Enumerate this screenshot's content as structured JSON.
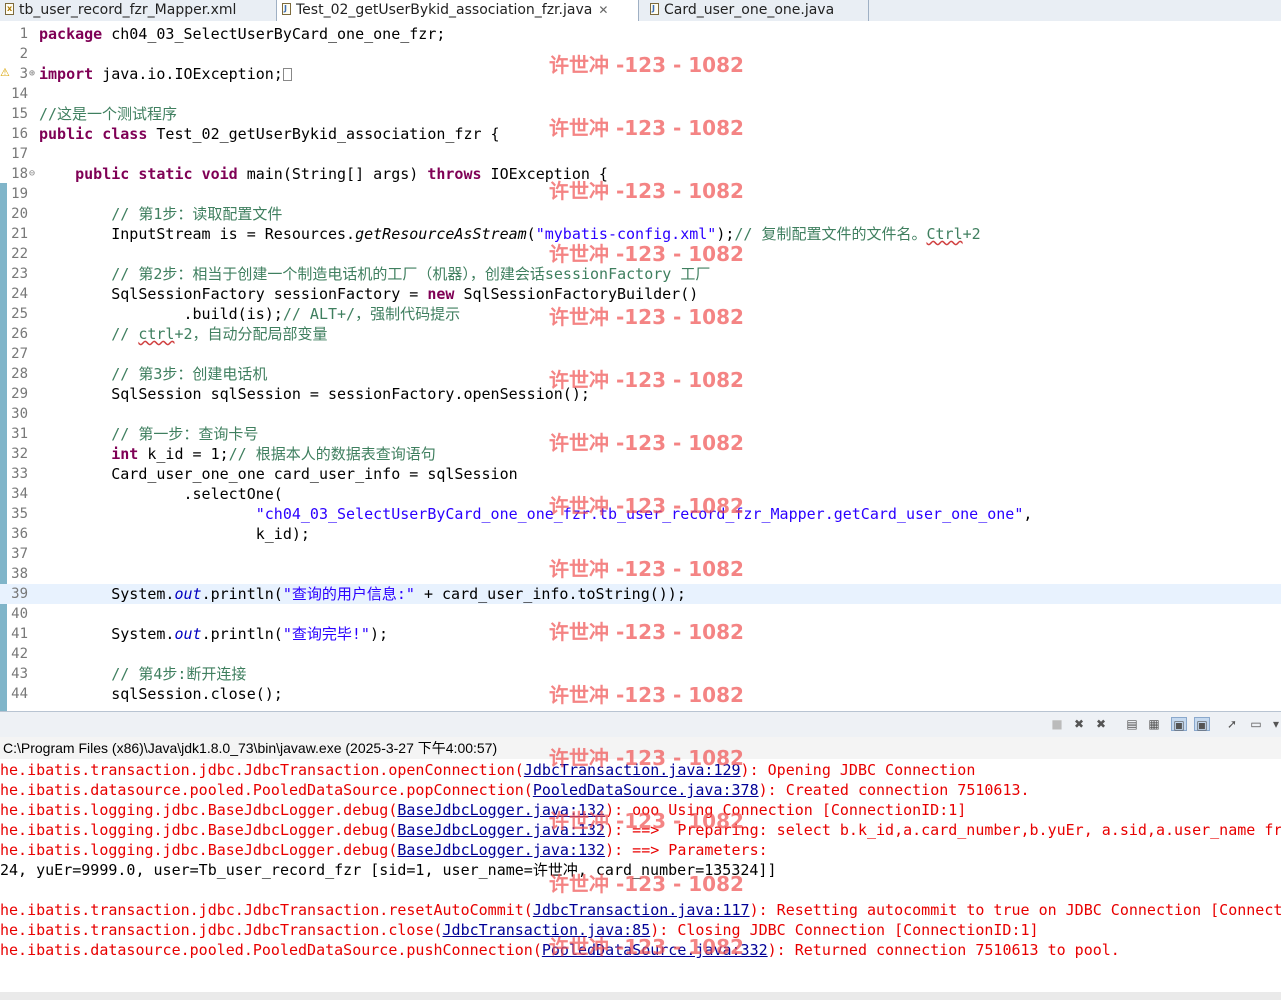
{
  "tabs": [
    {
      "label": "tb_user_record_fzr_Mapper.xml",
      "active": false,
      "icon": "xml-file-icon"
    },
    {
      "label": "Test_02_getUserBykid_association_fzr.java",
      "active": true,
      "icon": "java-file-icon",
      "close": "✕"
    },
    {
      "label": "Card_user_one_one.java",
      "active": false,
      "icon": "java-file-icon"
    }
  ],
  "editor": {
    "lines": [
      {
        "n": "1",
        "html": "<span class='kw'>package</span> ch04_03_SelectUserByCard_one_one_fzr;"
      },
      {
        "n": "2",
        "html": ""
      },
      {
        "n": "3",
        "warn": true,
        "fold": "⊕",
        "html": "<span class='kw'>import</span> java.io.IOException;<span class='fold-box'></span>"
      },
      {
        "n": "14",
        "html": ""
      },
      {
        "n": "15",
        "html": "<span class='cm'>//这是一个测试程序</span>"
      },
      {
        "n": "16",
        "html": "<span class='kw'>public</span> <span class='kw'>class</span> Test_02_getUserBykid_association_fzr {"
      },
      {
        "n": "17",
        "html": ""
      },
      {
        "n": "18",
        "fold": "⊖",
        "html": "    <span class='kw'>public</span> <span class='kw'>static</span> <span class='kw'>void</span> main(String[] args) <span class='kw'>throws</span> IOException {"
      },
      {
        "n": "19",
        "html": ""
      },
      {
        "n": "20",
        "html": "        <span class='cm'>// 第1步：读取配置文件</span>"
      },
      {
        "n": "21",
        "html": "        InputStream is = Resources.<span class='itm'>getResourceAsStream</span>(<span class='st'>\"mybatis-config.xml\"</span>);<span class='cm'>// 复制配置文件的文件名。<span class='sp'>Ctrl</span>+2</span>"
      },
      {
        "n": "22",
        "html": ""
      },
      {
        "n": "23",
        "html": "        <span class='cm'>// 第2步：相当于创建一个制造电话机的工厂（机器），创建会话sessionFactory 工厂</span>"
      },
      {
        "n": "24",
        "html": "        SqlSessionFactory sessionFactory = <span class='kw'>new</span> SqlSessionFactoryBuilder()"
      },
      {
        "n": "25",
        "html": "                .build(is);<span class='cm'>// ALT+/，强制代码提示</span>"
      },
      {
        "n": "26",
        "html": "        <span class='cm'>// <span class='sp'>ctrl</span>+2，自动分配局部变量</span>"
      },
      {
        "n": "27",
        "html": ""
      },
      {
        "n": "28",
        "html": "        <span class='cm'>// 第3步：创建电话机</span>"
      },
      {
        "n": "29",
        "html": "        SqlSession sqlSession = sessionFactory.openSession();"
      },
      {
        "n": "30",
        "html": ""
      },
      {
        "n": "31",
        "html": "        <span class='cm'>// 第一步：查询卡号</span>"
      },
      {
        "n": "32",
        "html": "        <span class='kw'>int</span> k_id = 1;<span class='cm'>// 根据本人的数据表查询语句</span>"
      },
      {
        "n": "33",
        "html": "        Card_user_one_one card_user_info = sqlSession"
      },
      {
        "n": "34",
        "html": "                .selectOne("
      },
      {
        "n": "35",
        "html": "                        <span class='st'>\"ch04_03_SelectUserByCard_one_one_fzr.tb_user_record_fzr_Mapper.getCard_user_one_one\"</span>,"
      },
      {
        "n": "36",
        "html": "                        k_id);"
      },
      {
        "n": "37",
        "html": ""
      },
      {
        "n": "38",
        "html": ""
      },
      {
        "n": "39",
        "hl": true,
        "html": "        System.<span class='fd'>out</span>.println(<span class='st'>\"查询的用户信息:\"</span> + card_user_info.toString());"
      },
      {
        "n": "40",
        "html": ""
      },
      {
        "n": "41",
        "html": "        System.<span class='fd'>out</span>.println(<span class='st'>\"查询完毕!\"</span>);"
      },
      {
        "n": "42",
        "html": ""
      },
      {
        "n": "43",
        "html": "        <span class='cm'>// 第4步:断开连接</span>"
      },
      {
        "n": "44",
        "html": "        sqlSession.close();"
      }
    ]
  },
  "console_toolbar": {
    "buttons": [
      {
        "name": "terminate-icon",
        "glyph": "■"
      },
      {
        "name": "remove-launch-icon",
        "glyph": "✖"
      },
      {
        "name": "remove-all-launches-icon",
        "glyph": "✖"
      },
      {
        "name": "clear-console-icon",
        "glyph": "▤"
      },
      {
        "name": "scroll-lock-icon",
        "glyph": "▦"
      },
      {
        "name": "show-on-stdout-icon",
        "glyph": "▣",
        "active": true
      },
      {
        "name": "show-on-stderr-icon",
        "glyph": "▣",
        "active": true
      },
      {
        "name": "pin-console-icon",
        "glyph": "➚"
      },
      {
        "name": "display-console-icon",
        "glyph": "▭"
      },
      {
        "name": "view-menu-icon",
        "glyph": "▾"
      }
    ]
  },
  "console": {
    "terminated": "C:\\Program Files (x86)\\Java\\jdk1.8.0_73\\bin\\javaw.exe (2025-3-27 下午4:00:57)",
    "lines": [
      {
        "html": "he.ibatis.transaction.jdbc.JdbcTransaction.openConnection(<span class='lk'>JdbcTransaction.java:129</span>): Opening JDBC Connection"
      },
      {
        "html": "he.ibatis.datasource.pooled.PooledDataSource.popConnection(<span class='lk'>PooledDataSource.java:378</span>): Created connection 7510613."
      },
      {
        "html": "he.ibatis.logging.jdbc.BaseJdbcLogger.debug(<span class='lk'>BaseJdbcLogger.java:132</span>): ooo Using Connection [ConnectionID:1]"
      },
      {
        "html": "he.ibatis.logging.jdbc.BaseJdbcLogger.debug(<span class='lk'>BaseJdbcLogger.java:132</span>): ==>  Preparing: select b.k_id,a.card_number,b.yuEr, a.sid,a.user_name fr"
      },
      {
        "html": "he.ibatis.logging.jdbc.BaseJdbcLogger.debug(<span class='lk'>BaseJdbcLogger.java:132</span>): ==> Parameters: "
      },
      {
        "out": true,
        "html": "24, yuEr=9999.0, user=Tb_user_record_fzr [sid=1, user_name=许世冲, card_number=135324]]"
      },
      {
        "html": ""
      },
      {
        "html": "he.ibatis.transaction.jdbc.JdbcTransaction.resetAutoCommit(<span class='lk'>JdbcTransaction.java:117</span>): Resetting autocommit to true on JDBC Connection [Connect"
      },
      {
        "html": "he.ibatis.transaction.jdbc.JdbcTransaction.close(<span class='lk'>JdbcTransaction.java:85</span>): Closing JDBC Connection [ConnectionID:1]"
      },
      {
        "html": "he.ibatis.datasource.pooled.PooledDataSource.pushConnection(<span class='lk'>PooledDataSource.java:332</span>): Returned connection 7510613 to pool."
      }
    ]
  },
  "watermark": {
    "text": "许世冲 -123 - 1082",
    "count": 15
  }
}
